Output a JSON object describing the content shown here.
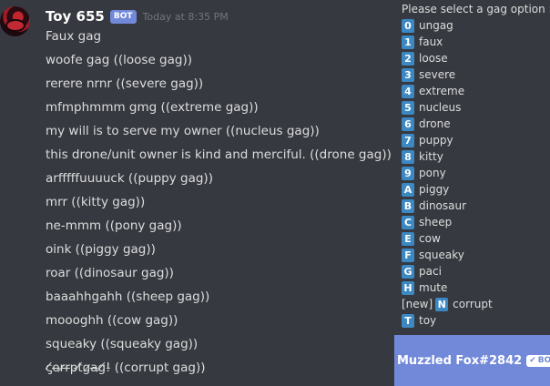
{
  "message": {
    "username": "Toy 655",
    "bot_tag": "BOT",
    "timestamp": "Today at 8:35 PM",
    "lines": [
      "Faux gag",
      "woofe gag  ((loose gag))",
      "rerere nrnr  ((severe gag))",
      "mfmphmmm gmg  ((extreme gag))",
      "my will is to serve my owner ((nucleus gag))",
      "this drone/unit owner is kind and merciful. ((drone gag))",
      "arfffffuuuuck ((puppy gag))",
      "mrr ((kitty gag))",
      "ne-mmm ((pony gag))",
      "oink ((piggy gag))",
      "roar ((dinosaur gag))",
      "baaahhgahh ((sheep gag))",
      "moooghh ((cow gag))",
      "squeaky ((squeaky gag))",
      "c̸̡o̶r̷r̶p̵t̸g̷a̶g̸!̵  ((corrupt gag))"
    ]
  },
  "gag_panel": {
    "title": "Please select a gag option :",
    "options": [
      {
        "key": "0",
        "label": "ungag"
      },
      {
        "key": "1",
        "label": "faux"
      },
      {
        "key": "2",
        "label": "loose"
      },
      {
        "key": "3",
        "label": "severe"
      },
      {
        "key": "4",
        "label": "extreme"
      },
      {
        "key": "5",
        "label": "nucleus"
      },
      {
        "key": "6",
        "label": "drone"
      },
      {
        "key": "7",
        "label": "puppy"
      },
      {
        "key": "8",
        "label": "kitty"
      },
      {
        "key": "9",
        "label": "pony"
      },
      {
        "key": "A",
        "label": "piggy"
      },
      {
        "key": "B",
        "label": "dinosaur"
      },
      {
        "key": "C",
        "label": "sheep"
      },
      {
        "key": "E",
        "label": "cow"
      },
      {
        "key": "F",
        "label": "squeaky"
      },
      {
        "key": "G",
        "label": "paci"
      },
      {
        "key": "H",
        "label": "mute"
      },
      {
        "key": "N",
        "label": "corrupt",
        "prefix": "[new]"
      },
      {
        "key": "T",
        "label": "toy"
      }
    ]
  },
  "user_strip": {
    "name": "Muzzled Fox#2842",
    "badge": "BOT",
    "badge_icon": "checkmark-icon"
  },
  "colors": {
    "background": "#36393f",
    "key_badge": "#3b88c3",
    "blurple": "#7289da"
  }
}
